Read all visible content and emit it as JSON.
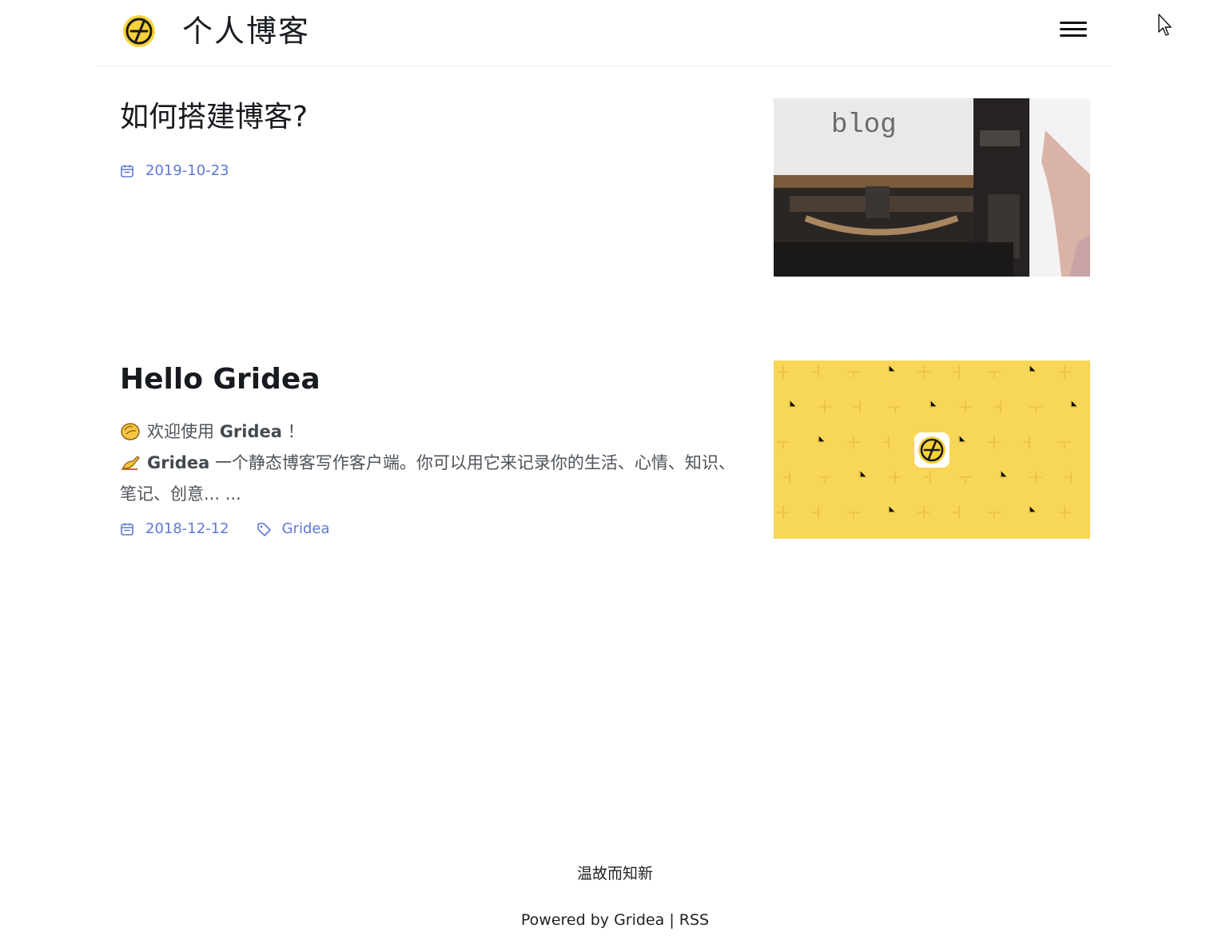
{
  "header": {
    "site_title": "个人博客",
    "menu_icon": "hamburger-menu-icon",
    "logo_icon": "gridea-logo-icon"
  },
  "posts": [
    {
      "title": "如何搭建博客?",
      "date": "2019-10-23",
      "thumbnail": "typewriter-blog-image",
      "thumbnail_text": "blog"
    },
    {
      "title": "Hello Gridea",
      "excerpt_line1_text": "欢迎使用",
      "excerpt_line1_bold": "Gridea",
      "excerpt_line1_end": "！",
      "excerpt_line2_bold": "Gridea",
      "excerpt_line2_text": "一个静态博客写作客户端。你可以用它来记录你的生活、心情、知识、笔记、创意... ...",
      "date": "2018-12-12",
      "tag": "Gridea",
      "thumbnail": "gridea-yellow-image"
    }
  ],
  "footer": {
    "motto": "温故而知新",
    "powered_prefix": "Powered by",
    "powered_link": "Gridea",
    "separator": "|",
    "rss_link": "RSS"
  },
  "colors": {
    "accent": "#5e78d3",
    "gridea_yellow": "#f8d658"
  }
}
